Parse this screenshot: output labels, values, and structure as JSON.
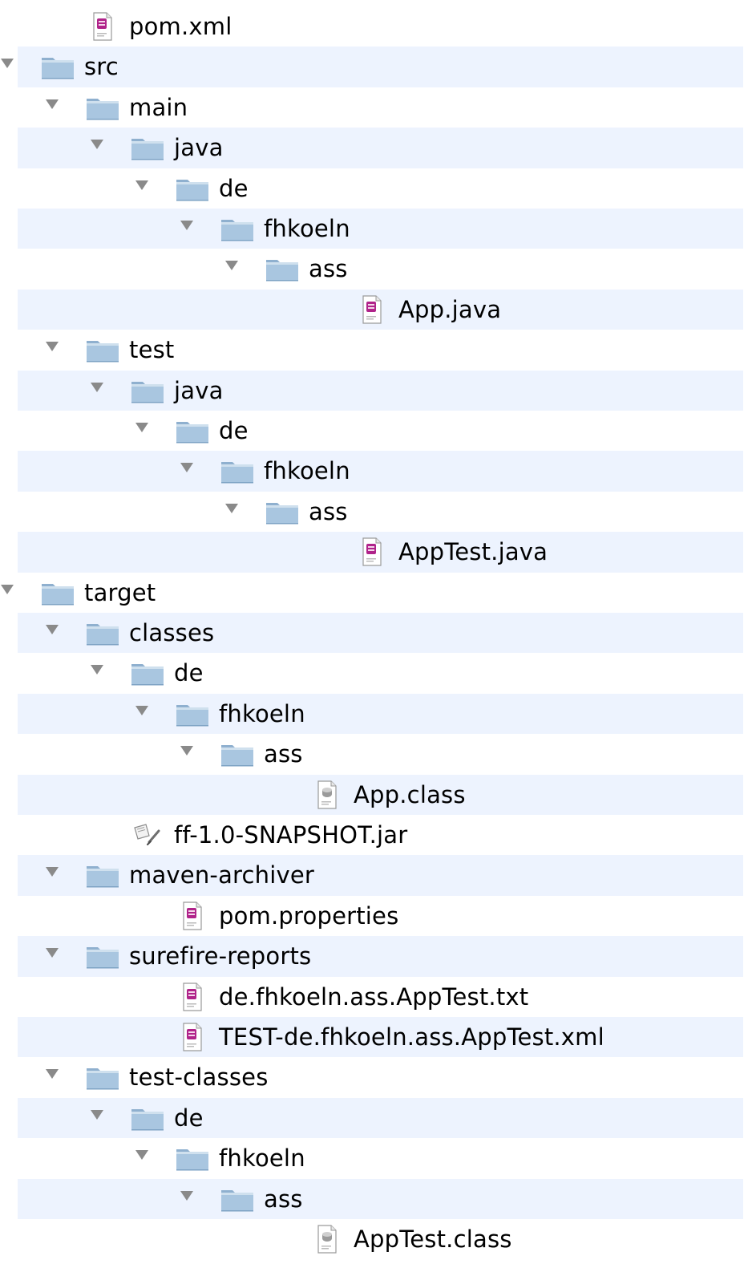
{
  "tree": {
    "rows": [
      {
        "label": "pom.xml",
        "level": 1,
        "type": "file-xml",
        "expanded": false
      },
      {
        "label": "src",
        "level": 0,
        "type": "folder",
        "expanded": true
      },
      {
        "label": "main",
        "level": 1,
        "type": "folder",
        "expanded": true
      },
      {
        "label": "java",
        "level": 2,
        "type": "folder",
        "expanded": true
      },
      {
        "label": "de",
        "level": 3,
        "type": "folder",
        "expanded": true
      },
      {
        "label": "fhkoeln",
        "level": 4,
        "type": "folder",
        "expanded": true
      },
      {
        "label": "ass",
        "level": 5,
        "type": "folder",
        "expanded": true
      },
      {
        "label": "App.java",
        "level": 7,
        "type": "file-java",
        "expanded": false
      },
      {
        "label": "test",
        "level": 1,
        "type": "folder",
        "expanded": true
      },
      {
        "label": "java",
        "level": 2,
        "type": "folder",
        "expanded": true
      },
      {
        "label": "de",
        "level": 3,
        "type": "folder",
        "expanded": true
      },
      {
        "label": "fhkoeln",
        "level": 4,
        "type": "folder",
        "expanded": true
      },
      {
        "label": "ass",
        "level": 5,
        "type": "folder",
        "expanded": true
      },
      {
        "label": "AppTest.java",
        "level": 7,
        "type": "file-java",
        "expanded": false
      },
      {
        "label": "target",
        "level": 0,
        "type": "folder",
        "expanded": true
      },
      {
        "label": "classes",
        "level": 1,
        "type": "folder",
        "expanded": true
      },
      {
        "label": "de",
        "level": 2,
        "type": "folder",
        "expanded": true
      },
      {
        "label": "fhkoeln",
        "level": 3,
        "type": "folder",
        "expanded": true
      },
      {
        "label": "ass",
        "level": 4,
        "type": "folder",
        "expanded": true
      },
      {
        "label": "App.class",
        "level": 6,
        "type": "file-class",
        "expanded": false
      },
      {
        "label": "ff-1.0-SNAPSHOT.jar",
        "level": 2,
        "type": "file-jar",
        "expanded": false
      },
      {
        "label": "maven-archiver",
        "level": 1,
        "type": "folder",
        "expanded": true
      },
      {
        "label": "pom.properties",
        "level": 3,
        "type": "file-props",
        "expanded": false
      },
      {
        "label": "surefire-reports",
        "level": 1,
        "type": "folder",
        "expanded": true
      },
      {
        "label": "de.fhkoeln.ass.AppTest.txt",
        "level": 3,
        "type": "file-txt",
        "expanded": false
      },
      {
        "label": "TEST-de.fhkoeln.ass.AppTest.xml",
        "level": 3,
        "type": "file-xml",
        "expanded": false
      },
      {
        "label": "test-classes",
        "level": 1,
        "type": "folder",
        "expanded": true
      },
      {
        "label": "de",
        "level": 2,
        "type": "folder",
        "expanded": true
      },
      {
        "label": "fhkoeln",
        "level": 3,
        "type": "folder",
        "expanded": true
      },
      {
        "label": "ass",
        "level": 4,
        "type": "folder",
        "expanded": true
      },
      {
        "label": "AppTest.class",
        "level": 6,
        "type": "file-class",
        "expanded": false
      }
    ]
  },
  "colors": {
    "alt_row": "#edf3fe",
    "folder_body": "#a9c6e0",
    "folder_tab": "#8fb0cf",
    "disclosure": "#8a8a8a",
    "doc_mark": "#b0238a"
  },
  "icons": {
    "folder": "folder-icon",
    "file-xml": "xml-file-icon",
    "file-java": "java-file-icon",
    "file-class": "class-file-icon",
    "file-jar": "jar-file-icon",
    "file-props": "properties-file-icon",
    "file-txt": "text-file-icon",
    "disclosure": "disclosure-triangle-icon"
  }
}
